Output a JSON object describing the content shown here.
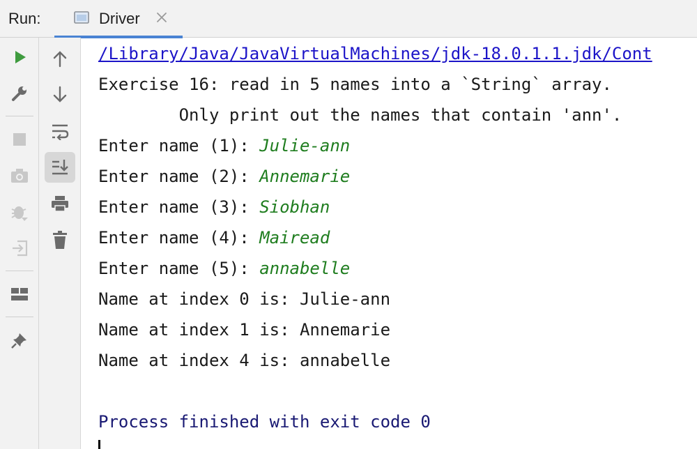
{
  "toolwindow": {
    "run_label": "Run:",
    "tab_title": "Driver"
  },
  "toolbar_left": [
    "rerun-icon",
    "wrench-icon",
    "stop-icon",
    "camera-icon",
    "debug-icon",
    "login-icon",
    "layout-icon",
    "pin-icon"
  ],
  "toolbar_right": [
    "arrow-up-icon",
    "arrow-down-icon",
    "soft-wrap-icon",
    "scroll-to-end-icon",
    "print-icon",
    "trash-icon"
  ],
  "console": {
    "path": "/Library/Java/JavaVirtualMachines/jdk-18.0.1.1.jdk/Cont",
    "line1": "Exercise 16: read in 5 names into a `String` array.",
    "line2": "        Only print out the names that contain 'ann'.",
    "prompts": [
      {
        "prompt": "Enter name (1): ",
        "input": "Julie-ann"
      },
      {
        "prompt": "Enter name (2): ",
        "input": "Annemarie"
      },
      {
        "prompt": "Enter name (3): ",
        "input": "Siobhan"
      },
      {
        "prompt": "Enter name (4): ",
        "input": "Mairead"
      },
      {
        "prompt": "Enter name (5): ",
        "input": "annabelle"
      }
    ],
    "results": [
      "Name at index 0 is: Julie-ann",
      "Name at index 1 is: Annemarie",
      "Name at index 4 is: annabelle"
    ],
    "exit": "Process finished with exit code 0"
  },
  "colors": {
    "path": "#1c14c8",
    "user_input": "#1f7d1f",
    "process": "#191973",
    "tab_accent": "#4a83d3",
    "run_green": "#3f9b3f"
  }
}
